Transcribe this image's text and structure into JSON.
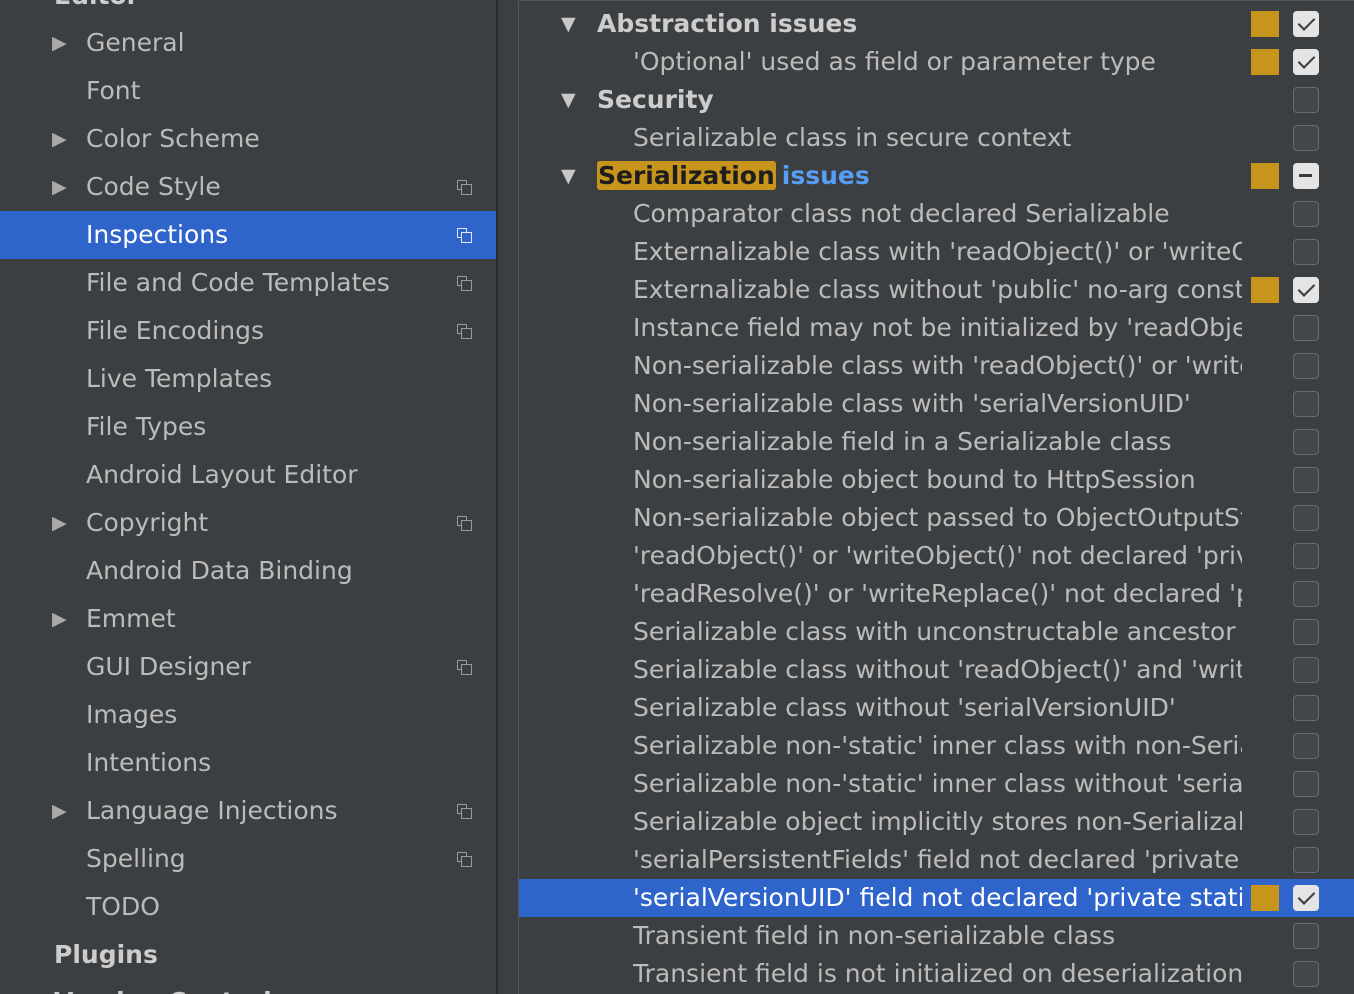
{
  "sidebar": {
    "section_editor": "Editor",
    "items": [
      {
        "label": "General",
        "expandable": true,
        "project_icon": false,
        "selected": false
      },
      {
        "label": "Font",
        "expandable": false,
        "project_icon": false,
        "selected": false
      },
      {
        "label": "Color Scheme",
        "expandable": true,
        "project_icon": false,
        "selected": false
      },
      {
        "label": "Code Style",
        "expandable": true,
        "project_icon": true,
        "selected": false
      },
      {
        "label": "Inspections",
        "expandable": false,
        "project_icon": true,
        "selected": true
      },
      {
        "label": "File and Code Templates",
        "expandable": false,
        "project_icon": true,
        "selected": false
      },
      {
        "label": "File Encodings",
        "expandable": false,
        "project_icon": true,
        "selected": false
      },
      {
        "label": "Live Templates",
        "expandable": false,
        "project_icon": false,
        "selected": false
      },
      {
        "label": "File Types",
        "expandable": false,
        "project_icon": false,
        "selected": false
      },
      {
        "label": "Android Layout Editor",
        "expandable": false,
        "project_icon": false,
        "selected": false
      },
      {
        "label": "Copyright",
        "expandable": true,
        "project_icon": true,
        "selected": false
      },
      {
        "label": "Android Data Binding",
        "expandable": false,
        "project_icon": false,
        "selected": false
      },
      {
        "label": "Emmet",
        "expandable": true,
        "project_icon": false,
        "selected": false
      },
      {
        "label": "GUI Designer",
        "expandable": false,
        "project_icon": true,
        "selected": false
      },
      {
        "label": "Images",
        "expandable": false,
        "project_icon": false,
        "selected": false
      },
      {
        "label": "Intentions",
        "expandable": false,
        "project_icon": false,
        "selected": false
      },
      {
        "label": "Language Injections",
        "expandable": true,
        "project_icon": true,
        "selected": false
      },
      {
        "label": "Spelling",
        "expandable": false,
        "project_icon": true,
        "selected": false
      },
      {
        "label": "TODO",
        "expandable": false,
        "project_icon": false,
        "selected": false
      }
    ],
    "section_plugins": "Plugins",
    "section_next": "Version Control"
  },
  "icons": {
    "expand_collapsed": "triangle-right-icon",
    "expand_expanded": "triangle-down-icon",
    "project_level": "copy-icon",
    "search": "search-icon"
  },
  "colors": {
    "selection": "#2f65ca",
    "severity_warning": "#c7951b",
    "search_highlight": "#c7951b",
    "search_match_keyword": "#589df6"
  },
  "inspections": {
    "rows": [
      {
        "kind": "group",
        "label": "Abstraction issues",
        "severity": true,
        "check": "on",
        "selected": false
      },
      {
        "kind": "item",
        "label": "'Optional' used as field or parameter type",
        "severity": true,
        "check": "on",
        "selected": false
      },
      {
        "kind": "group",
        "label": "Security",
        "severity": false,
        "check": "off",
        "selected": false
      },
      {
        "kind": "item",
        "label": "Serializable class in secure context",
        "severity": false,
        "check": "off",
        "selected": false
      },
      {
        "kind": "group",
        "label": "Serialization",
        "label_suffix": "issues",
        "severity": true,
        "check": "mixed",
        "selected": false
      },
      {
        "kind": "item",
        "label": "Comparator class not declared Serializable",
        "severity": false,
        "check": "off",
        "selected": false
      },
      {
        "kind": "item",
        "label": "Externalizable class with 'readObject()' or 'writeObject()'",
        "severity": false,
        "check": "off",
        "selected": false
      },
      {
        "kind": "item",
        "label": "Externalizable class without 'public' no-arg constructor",
        "severity": true,
        "check": "on",
        "selected": false
      },
      {
        "kind": "item",
        "label": "Instance field may not be initialized by 'readObject()'",
        "severity": false,
        "check": "off",
        "selected": false
      },
      {
        "kind": "item",
        "label": "Non-serializable class with 'readObject()' or 'writeObject()'",
        "severity": false,
        "check": "off",
        "selected": false
      },
      {
        "kind": "item",
        "label": "Non-serializable class with 'serialVersionUID'",
        "severity": false,
        "check": "off",
        "selected": false
      },
      {
        "kind": "item",
        "label": "Non-serializable field in a Serializable class",
        "severity": false,
        "check": "off",
        "selected": false
      },
      {
        "kind": "item",
        "label": "Non-serializable object bound to HttpSession",
        "severity": false,
        "check": "off",
        "selected": false
      },
      {
        "kind": "item",
        "label": "Non-serializable object passed to ObjectOutputStream",
        "severity": false,
        "check": "off",
        "selected": false
      },
      {
        "kind": "item",
        "label": "'readObject()' or 'writeObject()' not declared 'private'",
        "severity": false,
        "check": "off",
        "selected": false
      },
      {
        "kind": "item",
        "label": "'readResolve()' or 'writeReplace()' not declared 'protected'",
        "severity": false,
        "check": "off",
        "selected": false
      },
      {
        "kind": "item",
        "label": "Serializable class with unconstructable ancestor",
        "severity": false,
        "check": "off",
        "selected": false
      },
      {
        "kind": "item",
        "label": "Serializable class without 'readObject()' and 'writeObject()'",
        "severity": false,
        "check": "off",
        "selected": false
      },
      {
        "kind": "item",
        "label": "Serializable class without 'serialVersionUID'",
        "severity": false,
        "check": "off",
        "selected": false
      },
      {
        "kind": "item",
        "label": "Serializable non-'static' inner class with non-Serializable outer class",
        "severity": false,
        "check": "off",
        "selected": false
      },
      {
        "kind": "item",
        "label": "Serializable non-'static' inner class without 'serialVersionUID'",
        "severity": false,
        "check": "off",
        "selected": false
      },
      {
        "kind": "item",
        "label": "Serializable object implicitly stores non-Serializable object",
        "severity": false,
        "check": "off",
        "selected": false
      },
      {
        "kind": "item",
        "label": "'serialPersistentFields' field not declared 'private static final ObjectStreamField[]'",
        "severity": false,
        "check": "off",
        "selected": false
      },
      {
        "kind": "item",
        "label": "'serialVersionUID' field not declared 'private static final long'",
        "severity": true,
        "check": "on",
        "selected": true
      },
      {
        "kind": "item",
        "label": "Transient field in non-serializable class",
        "severity": false,
        "check": "off",
        "selected": false
      },
      {
        "kind": "item",
        "label": "Transient field is not initialized on deserialization",
        "severity": false,
        "check": "off",
        "selected": false
      }
    ]
  }
}
